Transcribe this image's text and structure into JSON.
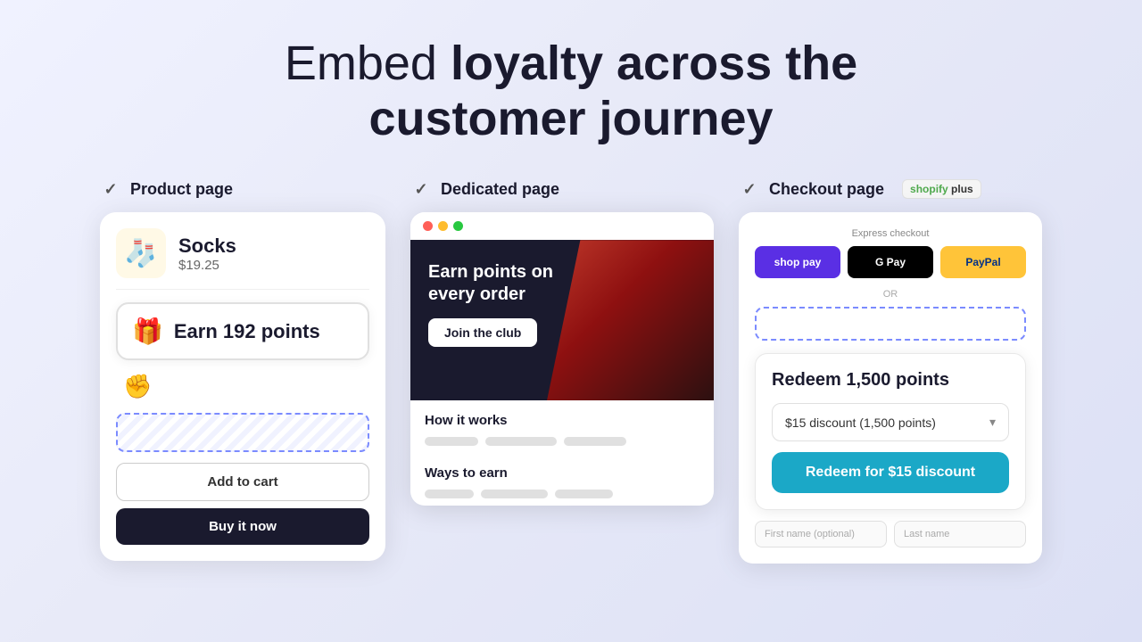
{
  "hero": {
    "title_light": "Embed",
    "title_bold": "loyalty across the customer journey"
  },
  "sections": [
    {
      "label": "Product page"
    },
    {
      "label": "Dedicated page"
    },
    {
      "label": "Checkout page"
    }
  ],
  "shopify_plus": "shopify plus",
  "product": {
    "icon": "🧦",
    "name": "Socks",
    "price": "$19.25"
  },
  "earn_points": {
    "icon": "🎁",
    "text": "Earn 192 points"
  },
  "buttons": {
    "add_to_cart": "Add to cart",
    "buy_it_now": "Buy it now"
  },
  "dedicated": {
    "hero_title": "Earn points on every order",
    "join_btn": "Join the club",
    "how_it_works": "How it works",
    "ways_to_earn": "Ways to earn"
  },
  "checkout": {
    "express_label": "Express checkout",
    "shop_pay": "shop pay",
    "g_pay": "G Pay",
    "paypal": "PayPal",
    "or": "OR",
    "redeem_title": "Redeem 1,500 points",
    "discount_option": "$15 discount (1,500 points)",
    "redeem_btn": "Redeem for $15 discount",
    "first_name_placeholder": "First name (optional)",
    "last_name_placeholder": "Last name"
  }
}
